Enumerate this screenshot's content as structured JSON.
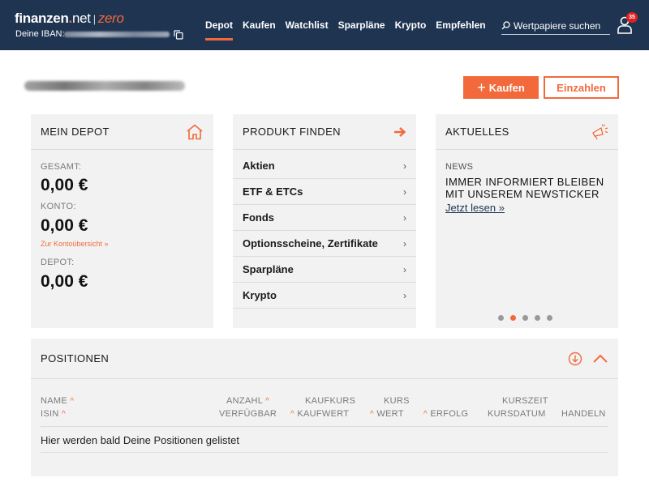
{
  "header": {
    "logo": {
      "brand": "finanzen",
      "dot": ".",
      "net": "net",
      "separator": "|",
      "product": "zero"
    },
    "iban_label": "Deine IBAN:",
    "nav": [
      {
        "label": "Depot",
        "active": true
      },
      {
        "label": "Kaufen",
        "active": false
      },
      {
        "label": "Watchlist",
        "active": false
      },
      {
        "label": "Sparpläne",
        "active": false
      },
      {
        "label": "Krypto",
        "active": false
      },
      {
        "label": "Empfehlen",
        "active": false
      }
    ],
    "search_placeholder": "Wertpapiere suchen",
    "notification_count": "35"
  },
  "actions": {
    "buy_label": "Kaufen",
    "deposit_label": "Einzahlen"
  },
  "depot_card": {
    "title": "MEIN DEPOT",
    "total_label": "GESAMT:",
    "total_value": "0,00 €",
    "account_label": "KONTO:",
    "account_value": "0,00 €",
    "account_link": "Zur Kontoübersicht »",
    "depot_label": "DEPOT:",
    "depot_value": "0,00 €"
  },
  "product_card": {
    "title": "PRODUKT FINDEN",
    "items": [
      "Aktien",
      "ETF & ETCs",
      "Fonds",
      "Optionsscheine, Zertifikate",
      "Sparpläne",
      "Krypto"
    ]
  },
  "news_card": {
    "title": "AKTUELLES",
    "label": "NEWS",
    "headline": "IMMER INFORMIERT BLEIBEN MIT UNSEREM NEWSTICKER",
    "link": "Jetzt lesen »",
    "slides": 5,
    "active_slide": 2
  },
  "positions": {
    "title": "POSITIONEN",
    "columns": {
      "name": "NAME",
      "isin": "ISIN",
      "anzahl": "ANZAHL",
      "verfuegbar": "VERFÜGBAR",
      "kaufkurs": "KAUFKURS",
      "kaufwert": "KAUFWERT",
      "kurs": "KURS",
      "wert": "WERT",
      "erfolg": "ERFOLG",
      "kurszeit": "KURSZEIT",
      "kursdatum": "KURSDATUM",
      "handeln": "HANDELN"
    },
    "empty_message": "Hier werden bald Deine Positionen gelistet"
  },
  "colors": {
    "header_bg": "#1e3451",
    "accent": "#f26a3c",
    "card_bg": "#f2f2f2"
  }
}
